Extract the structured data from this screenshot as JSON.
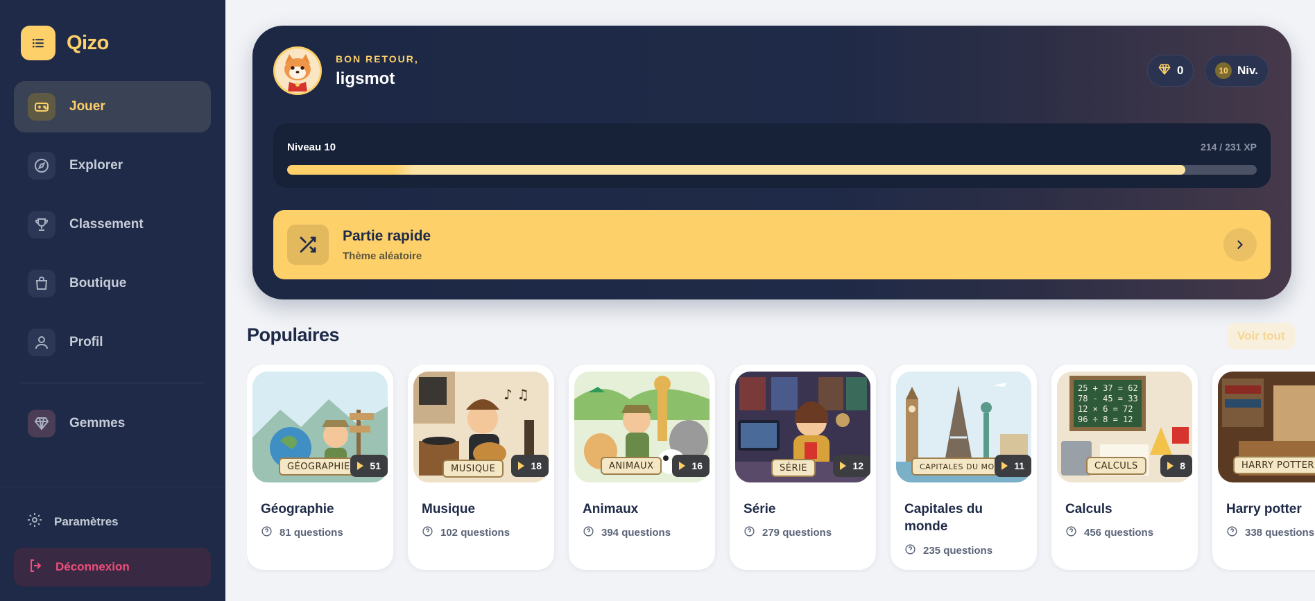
{
  "app": {
    "name": "Qizo"
  },
  "sidebar": {
    "items": [
      {
        "label": "Jouer",
        "icon": "gamepad-icon",
        "active": true
      },
      {
        "label": "Explorer",
        "icon": "compass-icon",
        "active": false
      },
      {
        "label": "Classement",
        "icon": "trophy-icon",
        "active": false
      },
      {
        "label": "Boutique",
        "icon": "shopping-bag-icon",
        "active": false
      },
      {
        "label": "Profil",
        "icon": "user-icon",
        "active": false
      }
    ],
    "gems_label": "Gemmes",
    "settings_label": "Paramètres",
    "logout_label": "Déconnexion"
  },
  "hero": {
    "welcome": "BON RETOUR,",
    "username": "ligsmot",
    "gems": "0",
    "level_badge": "10",
    "level_short": "Niv.",
    "progress": {
      "level_label": "Niveau 10",
      "xp_text": "214 / 231 XP",
      "fraction": 0.926
    },
    "quick_play": {
      "title": "Partie rapide",
      "subtitle": "Thème aléatoire"
    }
  },
  "popular": {
    "title": "Populaires",
    "see_all": "Voir tout",
    "cards": [
      {
        "title": "Géographie",
        "banner": "GÉOGRAPHIE",
        "plays": "51",
        "questions": "81 questions"
      },
      {
        "title": "Musique",
        "banner": "MUSIQUE",
        "plays": "18",
        "questions": "102 questions"
      },
      {
        "title": "Animaux",
        "banner": "ANIMAUX",
        "plays": "16",
        "questions": "394 questions"
      },
      {
        "title": "Série",
        "banner": "SÉRIE",
        "plays": "12",
        "questions": "279 questions"
      },
      {
        "title": "Capitales du monde",
        "banner": "CAPITALES DU MONDE",
        "plays": "11",
        "questions": "235 questions"
      },
      {
        "title": "Calculs",
        "banner": "CALCULS",
        "plays": "8",
        "questions": "456 questions"
      },
      {
        "title": "Harry potter",
        "banner": "HARRY POTTER",
        "plays": "",
        "questions": "338 questions"
      }
    ]
  },
  "colors": {
    "sidebar": "#1e2a47",
    "accent": "#fdd06a",
    "danger": "#f04e7c"
  }
}
